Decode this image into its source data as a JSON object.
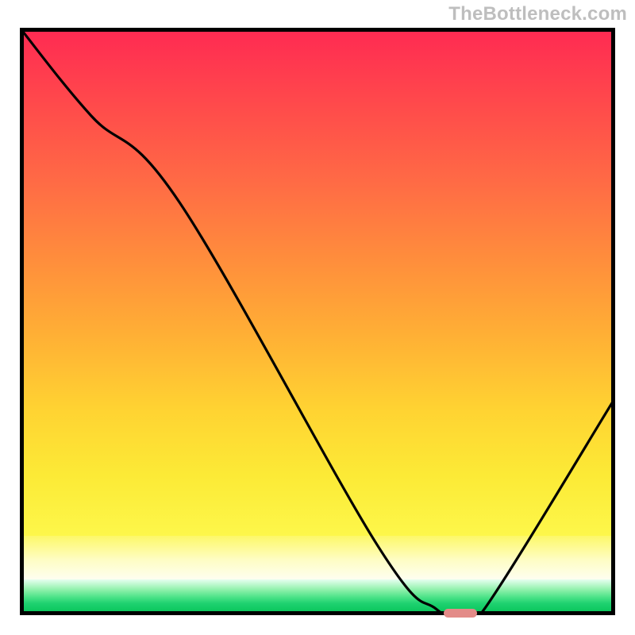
{
  "watermark": "TheBottleneck.com",
  "colors": {
    "frame": "#000000",
    "curve": "#000000",
    "marker": "#e38b88",
    "gradient_top": "#ff2b52",
    "gradient_bottom": "#0cc75e"
  },
  "chart_data": {
    "type": "line",
    "title": "",
    "xlabel": "",
    "ylabel": "",
    "xlim": [
      0,
      100
    ],
    "ylim": [
      0,
      100
    ],
    "background": "traffic-light-gradient",
    "series": [
      {
        "name": "bottleneck-curve",
        "x": [
          0,
          12,
          27,
          60,
          70,
          74,
          78,
          100
        ],
        "y": [
          100,
          85,
          70,
          12,
          1,
          0,
          1,
          37
        ]
      }
    ],
    "annotations": [
      {
        "name": "optimal-marker",
        "shape": "pill",
        "x_center": 74,
        "y_center": 0,
        "width_pct": 5.5,
        "height_pct": 1.5,
        "color": "#e38b88"
      }
    ]
  }
}
